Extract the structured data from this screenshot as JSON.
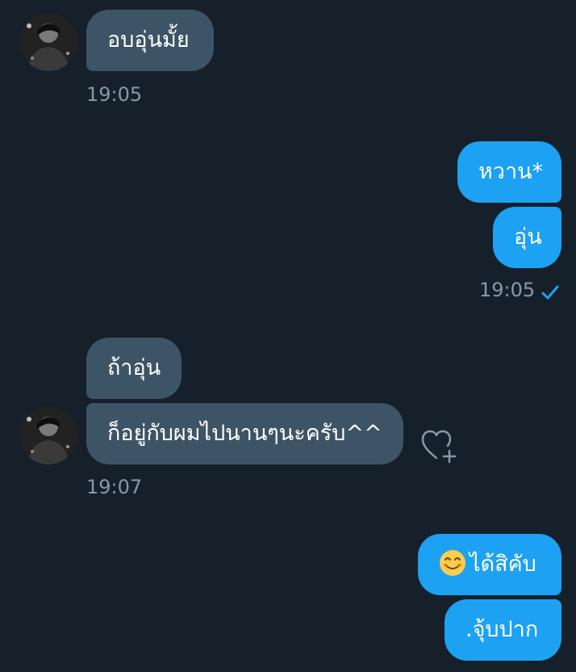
{
  "colors": {
    "background": "#15202b",
    "received_bubble": "#3d5466",
    "sent_bubble": "#1da1f2",
    "timestamp": "#8899a6",
    "read_check": "#1da1f2"
  },
  "messages": {
    "m1": {
      "text": "อบอุ่นมั้ย",
      "time": "19:05"
    },
    "m2": {
      "text": "หวาน*"
    },
    "m3": {
      "text": "อุ่น",
      "time": "19:05",
      "status_icon": "check-icon"
    },
    "m4": {
      "text": "ถ้าอุ่น"
    },
    "m5": {
      "text": "ก็อยู่กับผมไปนานๆนะครับ^^",
      "time": "19:07",
      "reaction_icon": "heart-plus-icon"
    },
    "m6": {
      "emoji_icon": "smiling-face-emoji-icon",
      "text": "ได้สิคับ"
    },
    "m7": {
      "text": ".จุ้บปาก"
    }
  }
}
